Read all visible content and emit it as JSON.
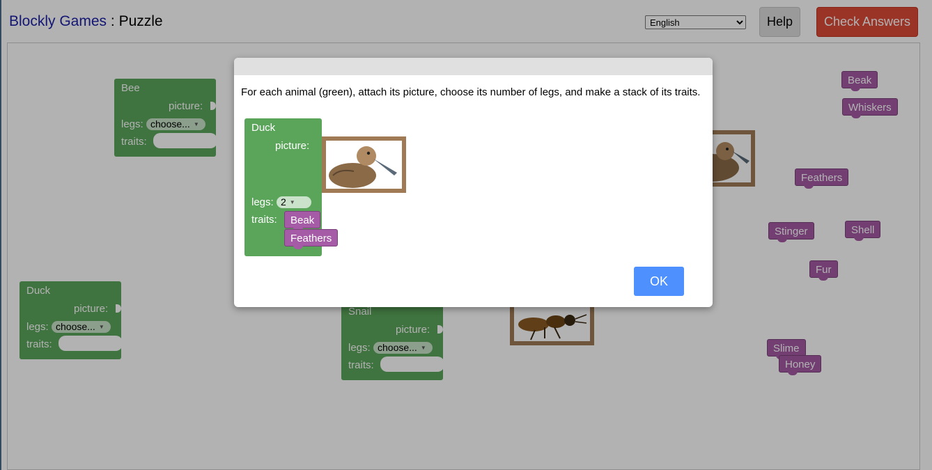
{
  "header": {
    "app_name": "Blockly Games",
    "separator": " : ",
    "page_name": "Puzzle",
    "language": "English",
    "help_label": "Help",
    "check_label": "Check Answers"
  },
  "workspace": {
    "blocks": [
      {
        "name": "Bee",
        "picture_label": "picture:",
        "legs_label": "legs:",
        "legs_value": "choose...",
        "traits_label": "traits:"
      },
      {
        "name": "Duck",
        "picture_label": "picture:",
        "legs_label": "legs:",
        "legs_value": "choose...",
        "traits_label": "traits:"
      },
      {
        "name": "Snail",
        "picture_label": "picture:",
        "legs_label": "legs:",
        "legs_value": "choose...",
        "traits_label": "traits:"
      }
    ],
    "traits": [
      "Beak",
      "Whiskers",
      "Feathers",
      "Stinger",
      "Shell",
      "Fur",
      "Slime",
      "Honey"
    ]
  },
  "dialog": {
    "instructions": "For each animal (green), attach its picture, choose its number of legs, and make a stack of its traits.",
    "example_block": {
      "name": "Duck",
      "picture_label": "picture:",
      "legs_label": "legs:",
      "legs_value": "2",
      "traits_label": "traits:",
      "traits": [
        "Beak",
        "Feathers"
      ]
    },
    "ok_label": "OK"
  },
  "colors": {
    "animal_block": "#5ba55b",
    "trait_block": "#a55ba5",
    "picture_frame": "#a07a55",
    "check_button": "#dd4b39",
    "ok_button": "#4d90fe",
    "title_link": "#1e22a6"
  }
}
